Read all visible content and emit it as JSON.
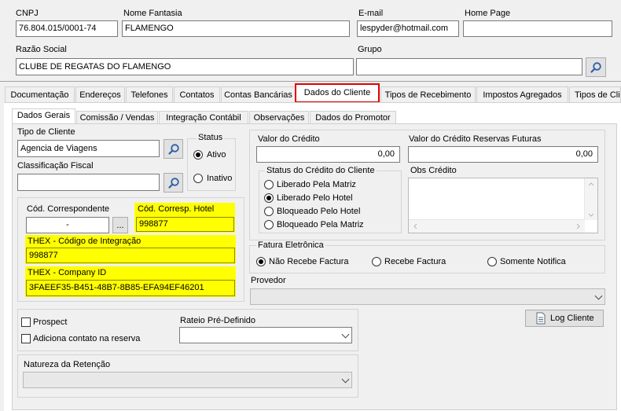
{
  "header": {
    "cnpj_label": "CNPJ",
    "cnpj_value": "76.804.015/0001-74",
    "fantasia_label": "Nome Fantasia",
    "fantasia_value": "FLAMENGO",
    "email_label": "E-mail",
    "email_value": "lespyder@hotmail.com",
    "homepage_label": "Home Page",
    "homepage_value": "",
    "razao_label": "Razão Social",
    "razao_value": "CLUBE DE REGATAS DO FLAMENGO",
    "grupo_label": "Grupo",
    "grupo_value": ""
  },
  "tabs": [
    "Documentação",
    "Endereços",
    "Telefones",
    "Contatos",
    "Contas Bancárias",
    "Dados do Cliente",
    "Tipos de Recebimento",
    "Impostos Agregados",
    "Tipos de Cli"
  ],
  "active_tab": "Dados do Cliente",
  "subtabs": [
    "Dados Gerais",
    "Comissão / Vendas",
    "Integração Contábil",
    "Observações",
    "Dados do Promotor"
  ],
  "active_subtab": "Dados Gerais",
  "form": {
    "tipo_cliente_label": "Tipo de Cliente",
    "tipo_cliente_value": "Agencia de Viagens",
    "classificacao_label": "Classificação Fiscal",
    "classificacao_value": "",
    "status_label": "Status",
    "status_ativo": "Ativo",
    "status_inativo": "Inativo",
    "status_selected": "Ativo",
    "cod_correspondente_label": "Cód. Correspondente",
    "cod_correspondente_value": "-",
    "cod_corresp_btn": "...",
    "cod_corresp_hotel_label": "Cód. Corresp. Hotel",
    "cod_corresp_hotel_value": "998877",
    "thex_codigo_label": "THEX - Código de Integração",
    "thex_codigo_value": "998877",
    "thex_company_label": "THEX - Company ID",
    "thex_company_value": "3FAEEF35-B451-48B7-8B85-EFA94EF46201",
    "valor_credito_label": "Valor do Crédito",
    "valor_credito_value": "0,00",
    "valor_reservas_label": "Valor do Crédito Reservas Futuras",
    "valor_reservas_value": "0,00",
    "status_credito_label": "Status do Crédito do Cliente",
    "status_credito_options": [
      "Liberado Pela Matriz",
      "Liberado Pelo Hotel",
      "Bloqueado Pelo Hotel",
      "Bloqueado Pela Matriz"
    ],
    "status_credito_selected": "Liberado Pelo Hotel",
    "obs_credito_label": "Obs Crédito",
    "fatura_label": "Fatura Eletrônica",
    "fatura_options": [
      "Não Recebe Factura",
      "Recebe Factura",
      "Somente Notifica"
    ],
    "fatura_selected": "Não Recebe Factura",
    "provedor_label": "Provedor",
    "provedor_value": "",
    "prospect_label": "Prospect",
    "adiciona_label": "Adiciona contato na reserva",
    "rateio_label": "Rateio Pré-Definido",
    "rateio_value": "",
    "log_cliente_label": "Log Cliente",
    "natureza_label": "Natureza da Retenção",
    "natureza_value": ""
  },
  "colors": {
    "highlight_yellow": "#ffff00",
    "active_tab_border": "#e00000",
    "search_icon": "#2b5fa8"
  },
  "icons": [
    "search-icon",
    "chevron-down-icon",
    "document-icon",
    "scroll-arrow-icon"
  ]
}
